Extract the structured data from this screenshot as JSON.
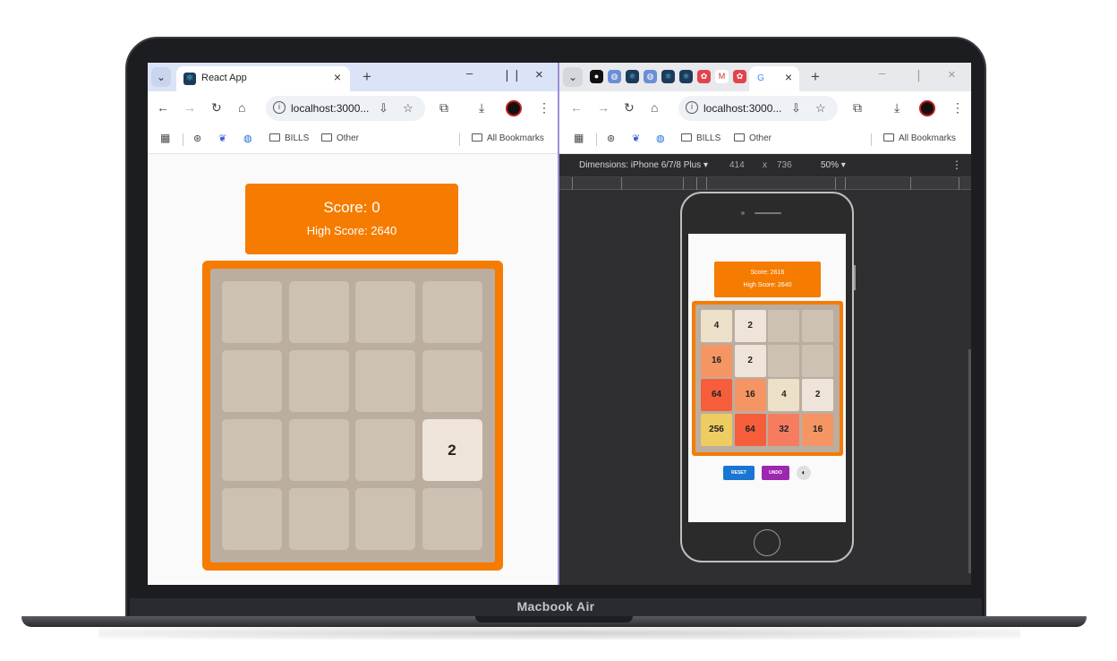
{
  "device": {
    "label": "Macbook Air"
  },
  "left_browser": {
    "tab_title": "React App",
    "url": "localhost:3000...",
    "bookmarks": [
      "BILLS",
      "Other"
    ],
    "all_bookmarks": "All Bookmarks"
  },
  "right_browser": {
    "url": "localhost:3000...",
    "bookmarks": [
      "BILLS",
      "Other"
    ],
    "all_bookmarks": "All Bookmarks",
    "devtools": {
      "dimensions_label": "Dimensions: iPhone 6/7/8 Plus",
      "width": "414",
      "times": "x",
      "height": "736",
      "zoom": "50%"
    }
  },
  "game_desktop": {
    "score_text": "Score: 0",
    "high_score_text": "High Score: 2640",
    "tiles": [
      [
        "",
        "",
        "",
        ""
      ],
      [
        "",
        "",
        "",
        ""
      ],
      [
        "",
        "",
        "",
        "2"
      ],
      [
        "",
        "",
        "",
        ""
      ]
    ]
  },
  "game_mobile": {
    "score_text": "Score: 2616",
    "high_score_text": "High Score: 2640",
    "tiles": [
      [
        "4",
        "2",
        "",
        ""
      ],
      [
        "16",
        "2",
        "",
        ""
      ],
      [
        "64",
        "16",
        "4",
        "2"
      ],
      [
        "256",
        "64",
        "32",
        "16"
      ]
    ],
    "reset_label": "RESET",
    "undo_label": "UNDO"
  },
  "colors": {
    "accent_orange": "#f57c00",
    "board_bg": "#bbada0",
    "empty_cell": "#cdc1b4",
    "tile_2": "#eee4da",
    "tile_4": "#ede0c8",
    "tile_16": "#f59563",
    "tile_32": "#f67c5f",
    "tile_64": "#f65e3b",
    "tile_256": "#edcc61",
    "reset_button": "#1976d2",
    "undo_button": "#9c27b0"
  }
}
